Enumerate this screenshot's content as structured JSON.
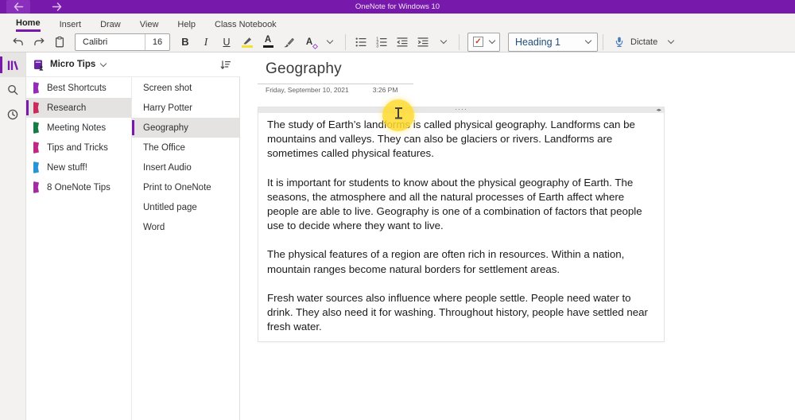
{
  "colors": {
    "accent": "#7719aa",
    "titlebar": "#7719aa",
    "selection_bg": "#e5e3e2",
    "heading_style_text": "#1f4e79",
    "dictate_blue": "#4a7ebb",
    "todo_check_red": "#c43e1c",
    "highlighter_yellow": "#f2e234",
    "click_indicator_yellow": "#ffdb2d"
  },
  "titlebar": {
    "title": "OneNote for Windows 10"
  },
  "menu": {
    "items": [
      {
        "label": "Home",
        "active": true
      },
      {
        "label": "Insert"
      },
      {
        "label": "Draw"
      },
      {
        "label": "View"
      },
      {
        "label": "Help"
      },
      {
        "label": "Class Notebook"
      }
    ]
  },
  "toolbar": {
    "font_name": "Calibri",
    "font_size": "16",
    "style_selected": "Heading 1",
    "dictate_label": "Dictate",
    "glyphs": {
      "bold": "B",
      "italic": "I",
      "underline": "U",
      "font_color": "A",
      "clear_formatting": "A",
      "check": "✓"
    },
    "icons": [
      "undo",
      "redo",
      "clipboard",
      "bold",
      "italic",
      "underline",
      "highlighter",
      "font-color",
      "format-painter",
      "clear-formatting",
      "more-formatting-chevron",
      "bullet-list",
      "numbered-list",
      "decrease-indent",
      "increase-indent",
      "more-lists-chevron",
      "todo-tag-checkbox",
      "tag-dropdown-chevron",
      "style-dropdown-chevron",
      "dictate-mic",
      "dictate-chevron"
    ]
  },
  "rail": {
    "items": [
      {
        "name": "notebooks",
        "icon": "books-icon",
        "active": true
      },
      {
        "name": "search",
        "icon": "search-icon"
      },
      {
        "name": "recent-notes",
        "icon": "clock-icon"
      }
    ]
  },
  "notebook": {
    "name": "Micro Tips",
    "icons": [
      "notebook-icon",
      "chevron-down-icon",
      "sort-icon"
    ],
    "sections": [
      {
        "label": "Best Shortcuts",
        "color": "#962bb5"
      },
      {
        "label": "Research",
        "color": "#cb2b5c",
        "selected": true
      },
      {
        "label": "Meeting Notes",
        "color": "#187a45"
      },
      {
        "label": "Tips and Tricks",
        "color": "#c02882"
      },
      {
        "label": "New stuff!",
        "color": "#2595d8"
      },
      {
        "label": "8 OneNote Tips",
        "color": "#a42ba3"
      }
    ]
  },
  "pages": {
    "items": [
      {
        "label": "Screen shot"
      },
      {
        "label": "Harry Potter"
      },
      {
        "label": "Geography",
        "selected": true
      },
      {
        "label": "The Office"
      },
      {
        "label": "Insert Audio"
      },
      {
        "label": "Print to OneNote"
      },
      {
        "label": "Untitled page"
      },
      {
        "label": "Word"
      }
    ]
  },
  "editor": {
    "page_title": "Geography",
    "date": "Friday, September 10, 2021",
    "time": "3:26 PM",
    "note_handle_dots": "····",
    "note_resize_glyph": "◂▸",
    "paragraphs": [
      "The study of Earth’s landforms is called physical geography.  Landforms can be mountains and valleys. They can also be glaciers or rivers. Landforms are sometimes called physical features.",
      "It is important for students to know about the physical geography of Earth. The seasons, the atmosphere and all the natural processes of Earth affect where people are able to live. Geography is one of a combination of factors that people use to decide where they want to live.",
      "The physical features of a region are often rich in resources. Within a nation, mountain ranges become natural borders for settlement areas.",
      "Fresh water sources also influence where people settle. People need water to drink. They also need it for washing. Throughout history, people have settled near fresh water."
    ]
  }
}
